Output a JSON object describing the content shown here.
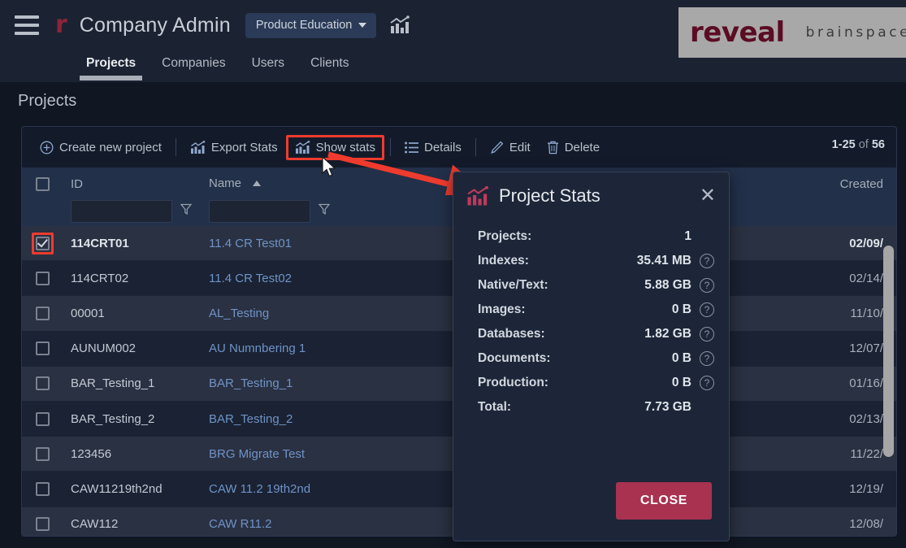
{
  "header": {
    "menu_icon": "hamburger-icon",
    "logo_letter": "r",
    "app_title": "Company Admin",
    "product_select": "Product Education",
    "chart_icon": "bar-chart-icon",
    "tabs": [
      {
        "label": "Projects",
        "active": true
      },
      {
        "label": "Companies",
        "active": false
      },
      {
        "label": "Users",
        "active": false
      },
      {
        "label": "Clients",
        "active": false
      }
    ]
  },
  "brand": {
    "primary": "reveal",
    "secondary": "brainspace"
  },
  "page": {
    "title": "Projects"
  },
  "toolbar": {
    "create": "Create new project",
    "export_stats": "Export Stats",
    "show_stats": "Show stats",
    "details": "Details",
    "edit": "Edit",
    "delete": "Delete",
    "pager_range": "1-25",
    "pager_of": " of ",
    "pager_total": "56"
  },
  "table": {
    "columns": {
      "id": "ID",
      "name": "Name",
      "created": "Created"
    },
    "sort": "asc",
    "filter_placeholder": "",
    "rows": [
      {
        "checked": true,
        "id": "114CRT01",
        "name": "11.4 CR Test01",
        "created": "02/09/"
      },
      {
        "checked": false,
        "id": "114CRT02",
        "name": "11.4 CR Test02",
        "created": "02/14/"
      },
      {
        "checked": false,
        "id": "00001",
        "name": "AL_Testing",
        "created": "11/10/"
      },
      {
        "checked": false,
        "id": "AUNUM002",
        "name": "AU Numnbering 1",
        "created": "12/07/"
      },
      {
        "checked": false,
        "id": "BAR_Testing_1",
        "name": "BAR_Testing_1",
        "created": "01/16/"
      },
      {
        "checked": false,
        "id": "BAR_Testing_2",
        "name": "BAR_Testing_2",
        "created": "02/13/"
      },
      {
        "checked": false,
        "id": "123456",
        "name": "BRG Migrate Test",
        "created": "11/22/"
      },
      {
        "checked": false,
        "id": "CAW11219th2nd",
        "name": "CAW 11.2 19th2nd",
        "created": "12/19/"
      },
      {
        "checked": false,
        "id": "CAW112",
        "name": "CAW R11.2",
        "created": "12/08/"
      }
    ]
  },
  "dialog": {
    "icon": "bar-chart-icon",
    "title": "Project Stats",
    "close_icon": "close-icon",
    "close_button": "CLOSE",
    "stats": [
      {
        "label": "Projects:",
        "value": "1",
        "help": false
      },
      {
        "label": "Indexes:",
        "value": "35.41 MB",
        "help": true
      },
      {
        "label": "Native/Text:",
        "value": "5.88 GB",
        "help": true
      },
      {
        "label": "Images:",
        "value": "0 B",
        "help": true
      },
      {
        "label": "Databases:",
        "value": "1.82 GB",
        "help": true
      },
      {
        "label": "Documents:",
        "value": "0 B",
        "help": true
      },
      {
        "label": "Production:",
        "value": "0 B",
        "help": true
      },
      {
        "label": "Total:",
        "value": "7.73 GB",
        "help": false
      }
    ],
    "help_glyph": "?"
  },
  "annotations": {
    "highlight_color": "#ef3b2d",
    "arrow": "red-arrow",
    "cursor": "mouse-cursor"
  },
  "colors": {
    "page_bg": "#101622",
    "nav_bg": "#1b2232",
    "dialog_bg": "#1c2638",
    "accent": "#a83250",
    "link": "#6f93c6"
  }
}
